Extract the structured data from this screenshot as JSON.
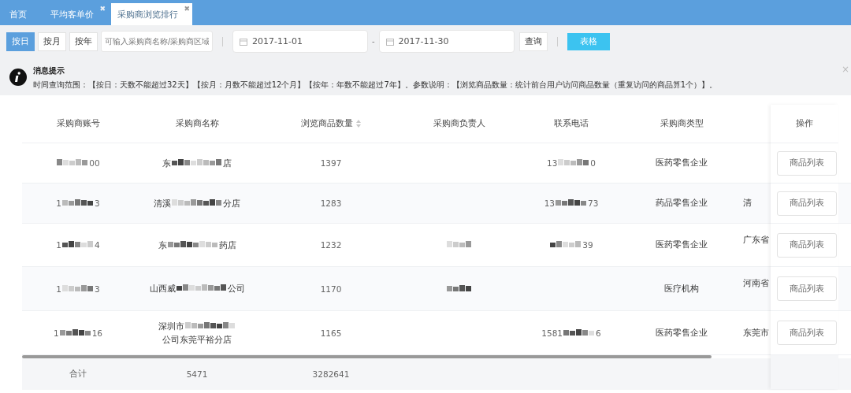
{
  "tabs": [
    {
      "label": "首页",
      "selected": false
    },
    {
      "label": "平均客单价",
      "selected": false,
      "close": "✖"
    },
    {
      "label": "采购商浏览排行",
      "selected": true,
      "close": "✖"
    }
  ],
  "toolbar": {
    "periods": [
      {
        "label": "按日",
        "selected": true
      },
      {
        "label": "按月",
        "selected": false
      },
      {
        "label": "按年",
        "selected": false
      }
    ],
    "search": {
      "placeholder": "可输入采购商名称/采购商区域"
    },
    "start_date": "2017-11-01",
    "date_separator": "-",
    "end_date": "2017-11-30",
    "query_button": "查询",
    "table_button": "表格"
  },
  "notice": {
    "title": "消息提示",
    "text": "时间查询范围：【按日：天数不能超过32天】【按月：月数不能超过12个月】【按年：年数不能超过7年】。参数说明：【浏览商品数量：统计前台用户访问商品数量（重复访问的商品算1个）】。",
    "close": "×"
  },
  "table": {
    "columns": [
      "采购商账号",
      "采购商名称",
      "浏览商品数量",
      "采购商负责人",
      "联系电话",
      "采购商类型"
    ],
    "action_column": "操作",
    "rows": [
      {
        "account": {
          "tail": "00"
        },
        "name": {
          "head": "东",
          "tail": "店"
        },
        "count": "1397",
        "phone": {
          "head": "13",
          "tail": "0"
        },
        "type": "医药零售企业",
        "action": "商品列表"
      },
      {
        "account": {
          "head": "1",
          "tail": "3"
        },
        "name": {
          "head": "清溪",
          "tail": "分店"
        },
        "count": "1283",
        "phone": {
          "head": "13",
          "tail": "73"
        },
        "type": "药品零售企业",
        "column_7": "清",
        "action": "商品列表"
      },
      {
        "account": {
          "head": "1",
          "tail": "4"
        },
        "name": {
          "head": "东",
          "tail": "药店"
        },
        "count": "1232",
        "person": {
          "redacted": true
        },
        "phone": {
          "tail": "39"
        },
        "type": "医药零售企业",
        "column_7": "广东省",
        "action": "商品列表"
      },
      {
        "account": {
          "head": "1",
          "tail": "3"
        },
        "name": {
          "head": "山西威",
          "tail": "公司"
        },
        "count": "1170",
        "person": {
          "redacted": true
        },
        "type": "医疗机构",
        "column_7": "河南省",
        "action": "商品列表"
      },
      {
        "account": {
          "head": "1",
          "tail": "16"
        },
        "name": {
          "head": "深圳市",
          "tail": "公司东莞平裕分店"
        },
        "count": "1165",
        "phone": {
          "head": "1581",
          "tail": "6"
        },
        "type": "医药零售企业",
        "column_7": "东莞市",
        "action": "商品列表"
      }
    ],
    "total": {
      "label": "合计",
      "name_total": "5471",
      "count_total": "3282641"
    }
  }
}
